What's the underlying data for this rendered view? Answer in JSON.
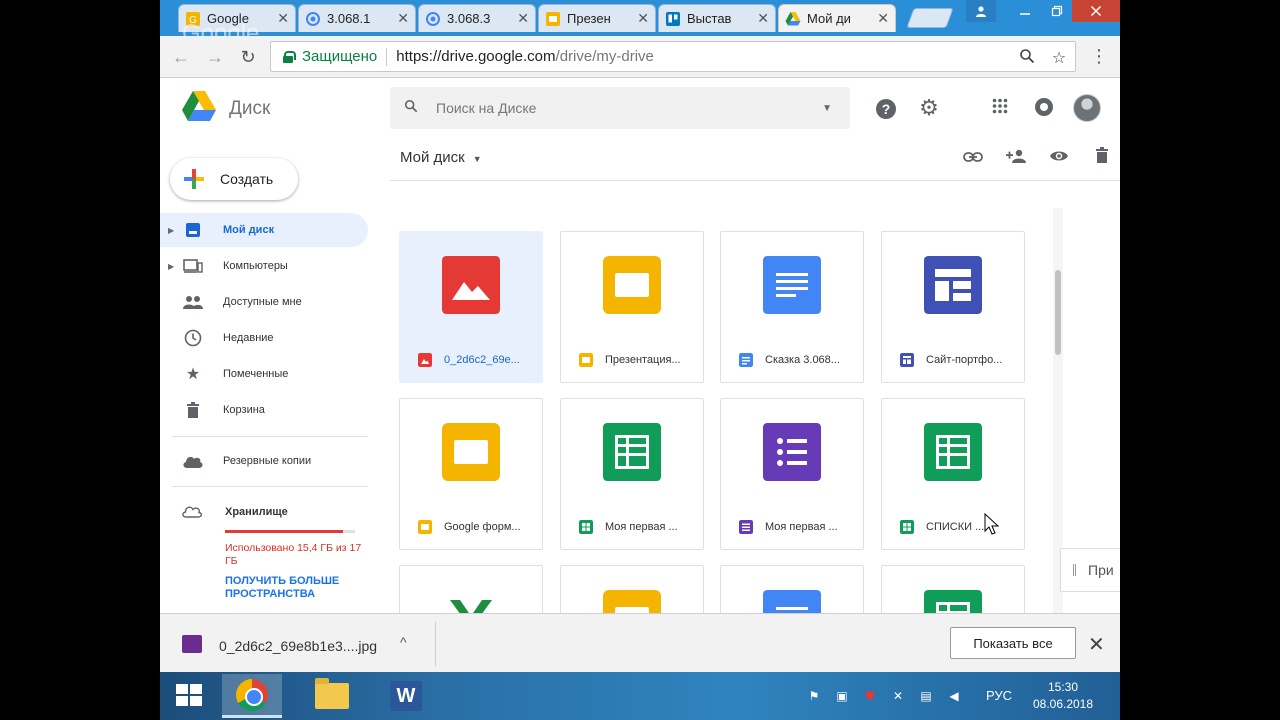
{
  "browser": {
    "tabs": [
      {
        "label": "Google",
        "icon": "google-icon",
        "color": "#f4b400"
      },
      {
        "label": "3.068.1",
        "icon": "loading-icon",
        "color": "#4285f4"
      },
      {
        "label": "3.068.3",
        "icon": "loading-icon",
        "color": "#4285f4"
      },
      {
        "label": "Презен",
        "icon": "slides-icon",
        "color": "#f4b400"
      },
      {
        "label": "Выстав",
        "icon": "trello-icon",
        "color": "#0079bf"
      },
      {
        "label": "Мой ди",
        "icon": "drive-icon",
        "color": "#1e8e3e"
      }
    ],
    "ghost_text": "Google",
    "secure_label": "Защищено",
    "url_host": "https://drive.google.com",
    "url_path": "/drive/my-drive"
  },
  "drive": {
    "title": "Диск",
    "search_placeholder": "Поиск на Диске",
    "create_label": "Создать",
    "breadcrumb": "Мой диск",
    "nav": [
      {
        "label": "Мой диск",
        "icon": "my-drive-icon"
      },
      {
        "label": "Компьютеры",
        "icon": "computers-icon"
      },
      {
        "label": "Доступные мне",
        "icon": "shared-icon"
      },
      {
        "label": "Недавние",
        "icon": "recent-icon"
      },
      {
        "label": "Помеченные",
        "icon": "starred-icon"
      },
      {
        "label": "Корзина",
        "icon": "trash-icon"
      },
      {
        "label": "Резервные копии",
        "icon": "backups-icon"
      }
    ],
    "storage": {
      "label": "Хранилище",
      "used_text": "Использовано 15,4 ГБ из 17 ГБ",
      "used_fraction": 0.906,
      "upgrade_link": "ПОЛУЧИТЬ БОЛЬШЕ ПРОСТРАНСТВА"
    },
    "files": [
      {
        "name": "0_2d6c2_69e...",
        "type": "image",
        "color": "#e53935"
      },
      {
        "name": "Презентация...",
        "type": "slides",
        "color": "#f4b400"
      },
      {
        "name": "Сказка 3.068...",
        "type": "docs",
        "color": "#4285f4"
      },
      {
        "name": "Сайт-портфо...",
        "type": "sites",
        "color": "#3f51b5"
      },
      {
        "name": "Google форм...",
        "type": "slides",
        "color": "#f4b400"
      },
      {
        "name": "Моя первая ...",
        "type": "sheets",
        "color": "#0f9d58"
      },
      {
        "name": "Моя первая ...",
        "type": "forms",
        "color": "#673ab7"
      },
      {
        "name": "СПИСКИ ...",
        "type": "sheets",
        "color": "#0f9d58"
      }
    ],
    "peek_label": "При"
  },
  "downloads": {
    "file_name": "0_2d6c2_69e8b1e3....jpg",
    "show_all": "Показать все"
  },
  "taskbar": {
    "lang": "РУС",
    "time": "15:30",
    "date": "08.06.2018"
  }
}
